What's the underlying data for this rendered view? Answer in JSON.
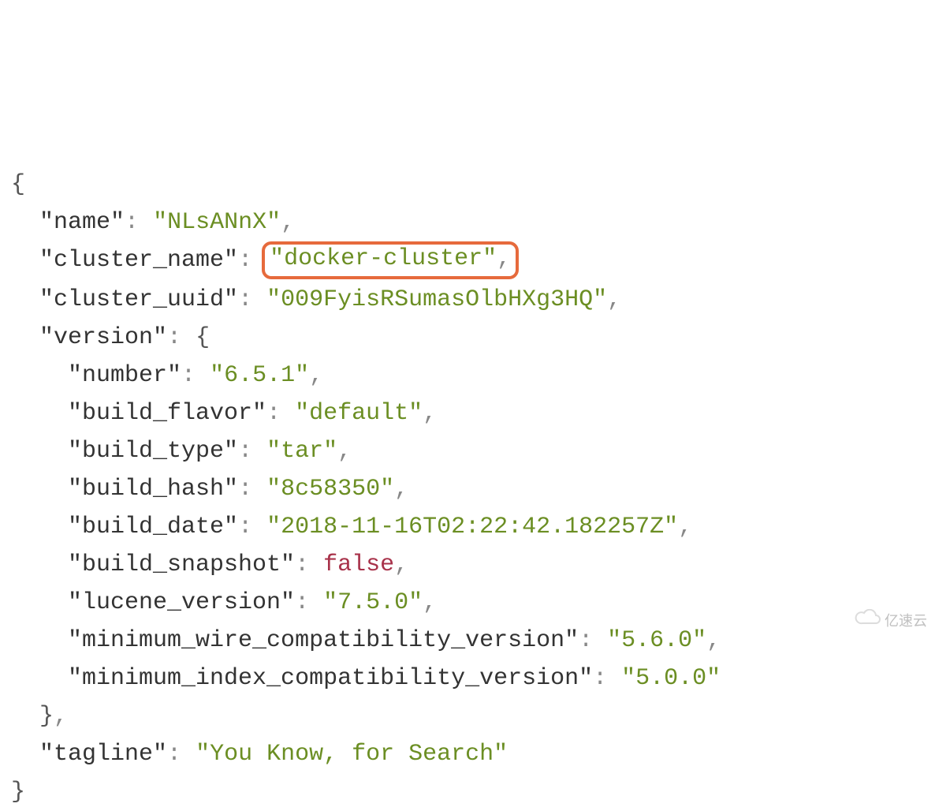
{
  "json": {
    "name_key": "\"name\"",
    "name_val": "\"NLsANnX\"",
    "cluster_name_key": "\"cluster_name\"",
    "cluster_name_val": "\"docker-cluster\"",
    "cluster_uuid_key": "\"cluster_uuid\"",
    "cluster_uuid_val": "\"009FyisRSumasOlbHXg3HQ\"",
    "version_key": "\"version\"",
    "number_key": "\"number\"",
    "number_val": "\"6.5.1\"",
    "build_flavor_key": "\"build_flavor\"",
    "build_flavor_val": "\"default\"",
    "build_type_key": "\"build_type\"",
    "build_type_val": "\"tar\"",
    "build_hash_key": "\"build_hash\"",
    "build_hash_val": "\"8c58350\"",
    "build_date_key": "\"build_date\"",
    "build_date_val": "\"2018-11-16T02:22:42.182257Z\"",
    "build_snapshot_key": "\"build_snapshot\"",
    "build_snapshot_val": "false",
    "lucene_version_key": "\"lucene_version\"",
    "lucene_version_val": "\"7.5.0\"",
    "min_wire_key": "\"minimum_wire_compatibility_version\"",
    "min_wire_val": "\"5.6.0\"",
    "min_index_key": "\"minimum_index_compatibility_version\"",
    "min_index_val": "\"5.0.0\"",
    "tagline_key": "\"tagline\"",
    "tagline_val": "\"You Know, for Search\""
  },
  "watermark": "亿速云"
}
